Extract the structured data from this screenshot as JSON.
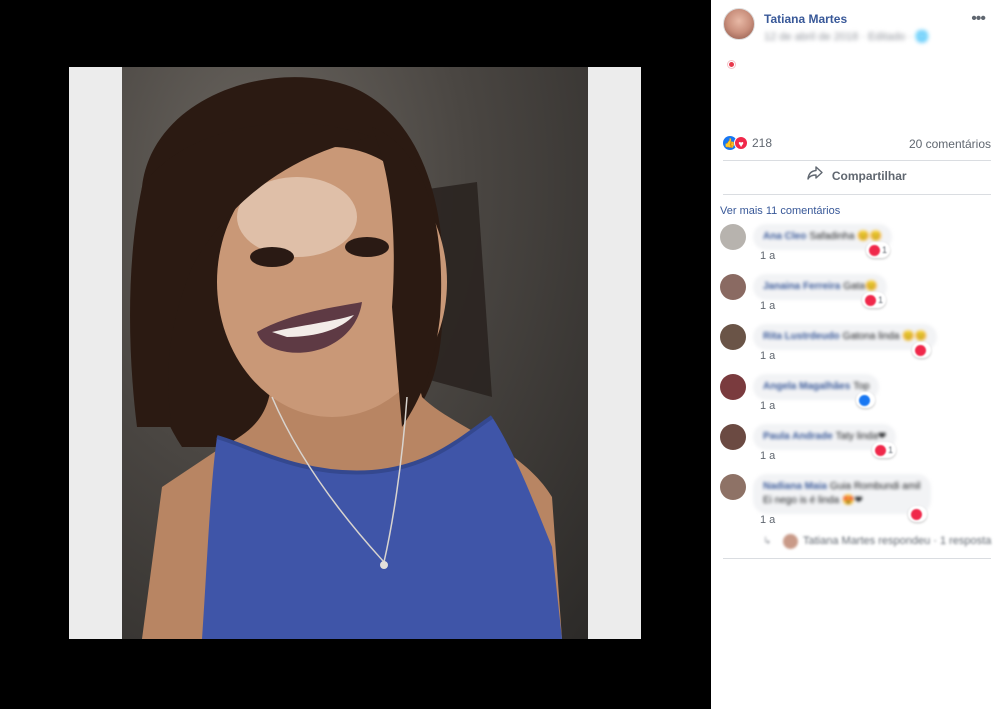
{
  "post": {
    "author": "Tatiana Martes",
    "meta": "12 de abril de 2018 · Editado ·",
    "reaction_count": "218",
    "comments_count": "20 comentários",
    "share_label": "Compartilhar",
    "see_more": "Ver mais 11 comentários"
  },
  "comments": [
    {
      "name": "Ana Cleo",
      "text": "Safadinha 😊😊",
      "time": "1 a",
      "react_count": "1",
      "avatar_color": "#b7b3ae"
    },
    {
      "name": "Janaina Ferreira",
      "text": "Gata😊",
      "time": "1 a",
      "react_count": "1",
      "avatar_color": "#8a6a62"
    },
    {
      "name": "Rita Lustrdeudo",
      "text": "Gatona linda 😊😊",
      "time": "1 a",
      "react_count": "",
      "avatar_color": "#6a5447"
    },
    {
      "name": "Angela Magalhães",
      "text": "Top",
      "time": "1 a",
      "react_count": "",
      "avatar_color": "#7a3b3e"
    },
    {
      "name": "Paula Andrade",
      "text": "Taty linda❤",
      "time": "1 a",
      "react_count": "1",
      "avatar_color": "#6b4a42"
    },
    {
      "name": "Nadiana Maia",
      "text": "Guia Rombundi amil",
      "text2": "Ei nego is é linda 😍❤",
      "time": "1 a",
      "react_count": "",
      "avatar_color": "#8e7266"
    }
  ],
  "reply": {
    "text": "Tatiana Martes respondeu · 1 resposta"
  },
  "colors": {
    "link": "#385898",
    "like": "#1877f2",
    "love": "#f0284a"
  }
}
